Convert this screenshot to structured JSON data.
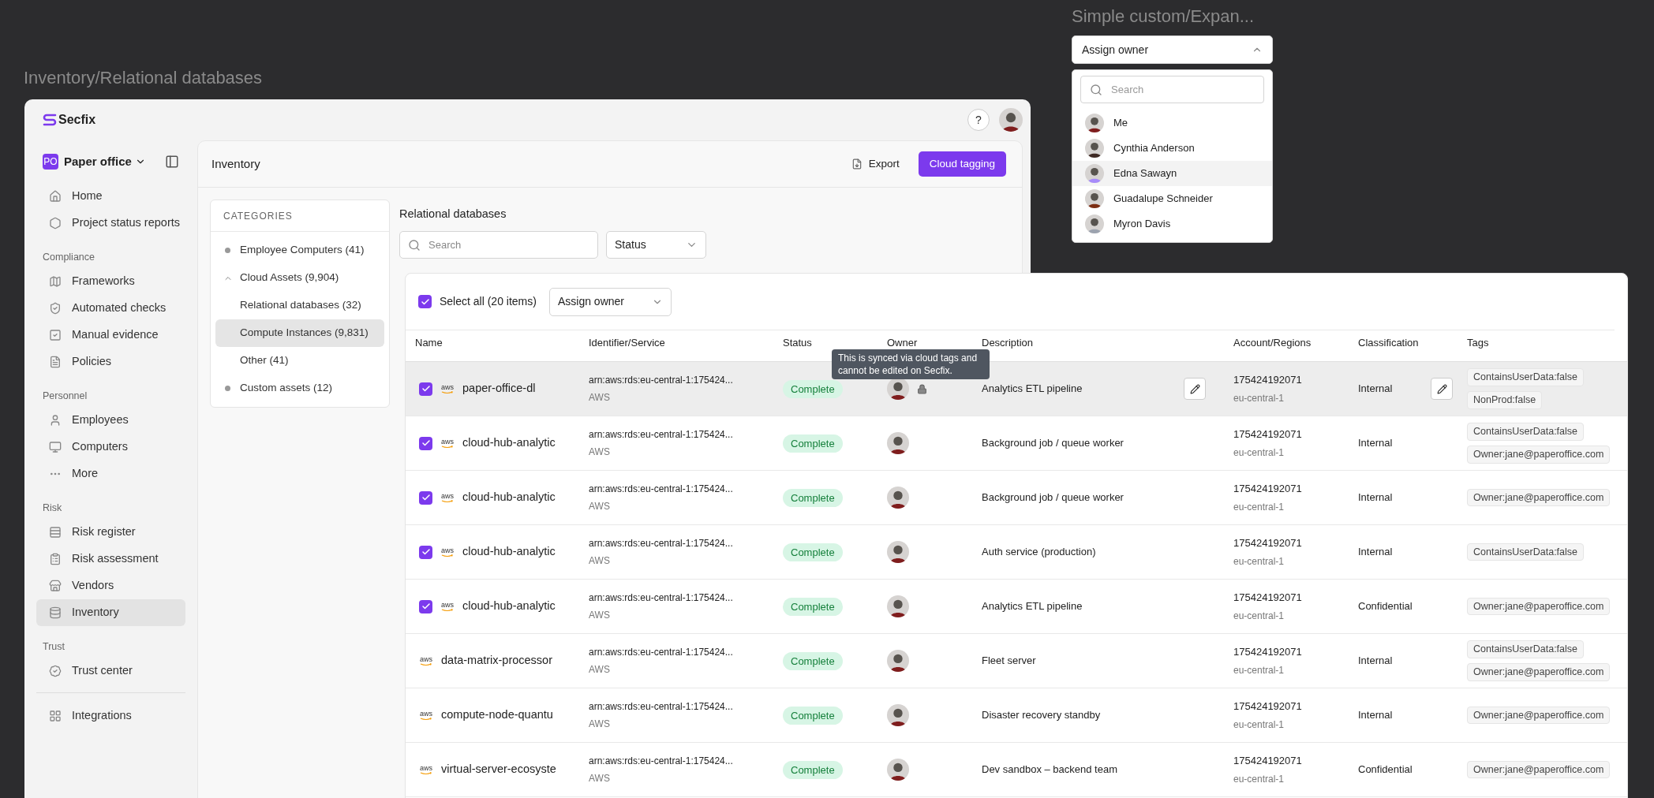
{
  "main_frame": {
    "title": "Inventory/Relational databases"
  },
  "app": {
    "logo": "Secfix",
    "help": "?",
    "org": {
      "initials": "PO",
      "name": "Paper office"
    },
    "nav": [
      {
        "items": [
          {
            "label": "Home",
            "selected": false
          },
          {
            "label": "Project status reports",
            "selected": false
          }
        ]
      },
      {
        "heading": "Compliance",
        "items": [
          {
            "label": "Frameworks",
            "selected": false
          },
          {
            "label": "Automated checks",
            "selected": false
          },
          {
            "label": "Manual evidence",
            "selected": false
          },
          {
            "label": "Policies",
            "selected": false
          }
        ]
      },
      {
        "heading": "Personnel",
        "items": [
          {
            "label": "Employees",
            "selected": false
          },
          {
            "label": "Computers",
            "selected": false
          },
          {
            "label": "More",
            "selected": false
          }
        ]
      },
      {
        "heading": "Risk",
        "items": [
          {
            "label": "Risk register",
            "selected": false
          },
          {
            "label": "Risk assessment",
            "selected": false
          },
          {
            "label": "Vendors",
            "selected": false
          },
          {
            "label": "Inventory",
            "selected": true
          }
        ]
      },
      {
        "heading": "Trust",
        "items": [
          {
            "label": "Trust center",
            "selected": false
          }
        ]
      },
      {
        "items": [
          {
            "label": "Integrations",
            "selected": false
          }
        ]
      }
    ],
    "page": {
      "title": "Inventory",
      "export": "Export",
      "primary": "Cloud tagging"
    },
    "categories": {
      "heading": "CATEGORIES",
      "items": [
        {
          "label": "Employee Computers (41)",
          "selected": false
        },
        {
          "label": "Cloud Assets (9,904)",
          "selected": false,
          "expanded": true,
          "children": [
            {
              "label": "Relational databases (32)",
              "selected": false
            },
            {
              "label": "Compute Instances (9,831)",
              "selected": true
            },
            {
              "label": "Other (41)",
              "selected": false
            }
          ]
        },
        {
          "label": "Custom assets (12)",
          "selected": false
        }
      ]
    },
    "section": {
      "title": "Relational databases",
      "search_placeholder": "Search",
      "status_filter": "Status"
    }
  },
  "table": {
    "select_all": {
      "label": "Select all (20 items)",
      "checked": true
    },
    "assign_owner": "Assign owner",
    "columns": [
      "Name",
      "Identifier/Service",
      "Status",
      "Owner",
      "Description",
      "Account/Regions",
      "Classification",
      "Tags"
    ],
    "tooltip": "This is synced via cloud tags and cannot be edited on Secfix.",
    "rows": [
      {
        "checked": true,
        "hovered": true,
        "locked": true,
        "editable": true,
        "logo": "aws",
        "name": "paper-office-dl",
        "identifier": "arn:aws:rds:eu-central-1:175424...",
        "service": "AWS",
        "status": "Complete",
        "description": "Analytics ETL pipeline",
        "account": "175424192071",
        "region": "eu-central-1",
        "classification": "Internal",
        "tags": [
          "ContainsUserData:false",
          "NonProd:false"
        ]
      },
      {
        "checked": true,
        "hovered": false,
        "locked": false,
        "editable": false,
        "logo": "aws",
        "name": "cloud-hub-analytic",
        "identifier": "arn:aws:rds:eu-central-1:175424...",
        "service": "AWS",
        "status": "Complete",
        "description": "Background job / queue worker",
        "account": "175424192071",
        "region": "eu-central-1",
        "classification": "Internal",
        "tags": [
          "ContainsUserData:false",
          "Owner:jane@paperoffice.com"
        ]
      },
      {
        "checked": true,
        "hovered": false,
        "locked": false,
        "editable": false,
        "logo": "aws",
        "name": "cloud-hub-analytic",
        "identifier": "arn:aws:rds:eu-central-1:175424...",
        "service": "AWS",
        "status": "Complete",
        "description": "Background job / queue worker",
        "account": "175424192071",
        "region": "eu-central-1",
        "classification": "Internal",
        "tags": [
          "Owner:jane@paperoffice.com"
        ]
      },
      {
        "checked": true,
        "hovered": false,
        "locked": false,
        "editable": false,
        "logo": "aws",
        "name": "cloud-hub-analytic",
        "identifier": "arn:aws:rds:eu-central-1:175424...",
        "service": "AWS",
        "status": "Complete",
        "description": "Auth service (production)",
        "account": "175424192071",
        "region": "eu-central-1",
        "classification": "Internal",
        "tags": [
          "ContainsUserData:false"
        ]
      },
      {
        "checked": true,
        "hovered": false,
        "locked": false,
        "editable": false,
        "logo": "aws",
        "name": "cloud-hub-analytic",
        "identifier": "arn:aws:rds:eu-central-1:175424...",
        "service": "AWS",
        "status": "Complete",
        "description": "Analytics ETL pipeline",
        "account": "175424192071",
        "region": "eu-central-1",
        "classification": "Confidential",
        "tags": [
          "Owner:jane@paperoffice.com"
        ]
      },
      {
        "checked": false,
        "hovered": false,
        "locked": false,
        "editable": false,
        "logo": "aws",
        "name": "data-matrix-processor",
        "identifier": "arn:aws:rds:eu-central-1:175424...",
        "service": "AWS",
        "status": "Complete",
        "description": "Fleet server",
        "account": "175424192071",
        "region": "eu-central-1",
        "classification": "Internal",
        "tags": [
          "ContainsUserData:false",
          "Owner:jane@paperoffice.com"
        ]
      },
      {
        "checked": false,
        "hovered": false,
        "locked": false,
        "editable": false,
        "logo": "aws",
        "name": "compute-node-quantu",
        "identifier": "arn:aws:rds:eu-central-1:175424...",
        "service": "AWS",
        "status": "Complete",
        "description": "Disaster recovery standby",
        "account": "175424192071",
        "region": "eu-central-1",
        "classification": "Internal",
        "tags": [
          "Owner:jane@paperoffice.com"
        ]
      },
      {
        "checked": false,
        "hovered": false,
        "locked": false,
        "editable": false,
        "logo": "aws",
        "name": "virtual-server-ecosyste",
        "identifier": "arn:aws:rds:eu-central-1:175424...",
        "service": "AWS",
        "status": "Complete",
        "description": "Dev sandbox – backend team",
        "account": "175424192071",
        "region": "eu-central-1",
        "classification": "Confidential",
        "tags": [
          "Owner:jane@paperoffice.com"
        ]
      }
    ]
  },
  "dropdown_frame": {
    "title": "Simple custom/Expan...",
    "trigger": "Assign owner",
    "expanded": true,
    "search_placeholder": "Search",
    "options": [
      {
        "name": "Me",
        "highlighted": false
      },
      {
        "name": "Cynthia Anderson",
        "highlighted": false
      },
      {
        "name": "Edna Sawayn",
        "highlighted": true
      },
      {
        "name": "Guadalupe Schneider",
        "highlighted": false
      },
      {
        "name": "Myron Davis",
        "highlighted": false
      }
    ]
  }
}
